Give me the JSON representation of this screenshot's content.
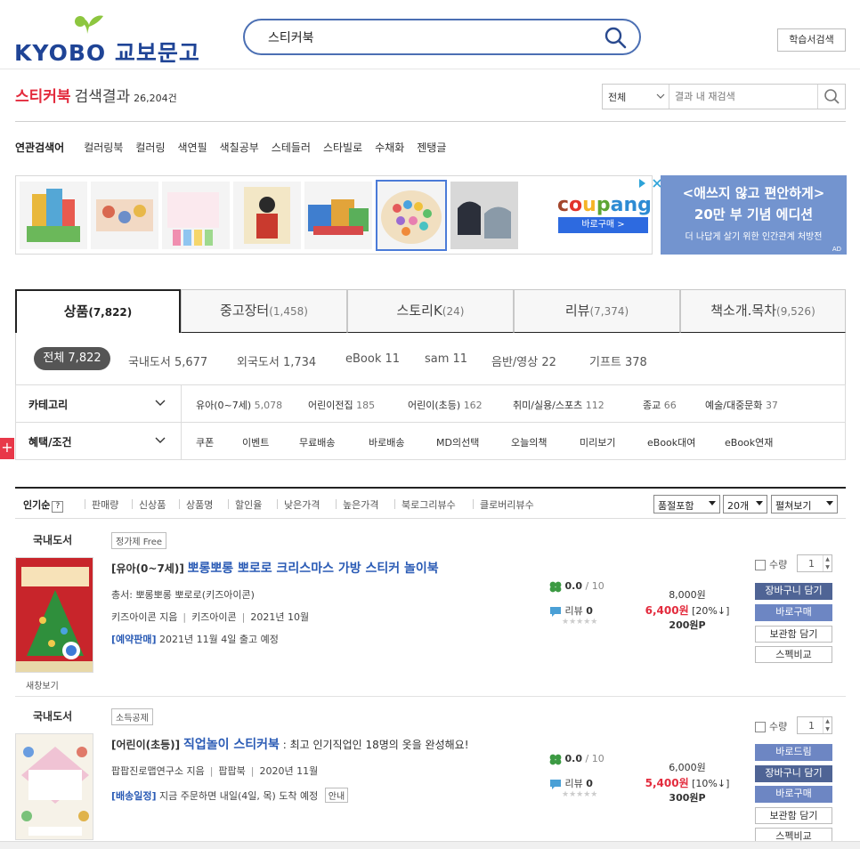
{
  "header": {
    "logo_text": "KYOBO 교보문고",
    "search_value": "스티커북",
    "study_search_label": "학습서검색"
  },
  "result": {
    "keyword": "스티커북",
    "label": "검색결과",
    "count": "26,204건",
    "scope_select": "전체",
    "inner_search_placeholder": "결과 내 재검색"
  },
  "related": {
    "label": "연관검색어",
    "keywords": [
      "컬러링북",
      "컬러링",
      "색연필",
      "색칠공부",
      "스테들러",
      "스타빌로",
      "수채화",
      "젠탱글"
    ]
  },
  "ads": {
    "coupang_brand": "coupang",
    "coupang_button": "바로구매 >",
    "banner_line1": "<애쓰지 않고 편안하게>",
    "banner_line2": "20만 부 기념 에디션",
    "banner_line3": "더 나답게 살기 위한 인간관계 처방전",
    "banner_ad": "AD",
    "colors": {
      "coupang_button": "#2d6ae0",
      "banner_bg": "#7394cf"
    }
  },
  "tabs": [
    {
      "label": "상품",
      "count": "(7,822)"
    },
    {
      "label": "중고장터",
      "count": "(1,458)"
    },
    {
      "label": "스토리K",
      "count": "(24)"
    },
    {
      "label": "리뷰",
      "count": "(7,374)"
    },
    {
      "label": "책소개.목차",
      "count": "(9,526)"
    }
  ],
  "subfilters": {
    "chip": "전체 7,822",
    "items": [
      "국내도서 5,677",
      "외국도서 1,734",
      "eBook 11",
      "sam 11",
      "음반/영상 22",
      "기프트 378"
    ]
  },
  "category": {
    "label": "카테고리",
    "items": [
      {
        "name": "유아(0~7세)",
        "count": "5,078"
      },
      {
        "name": "어린이전집",
        "count": "185"
      },
      {
        "name": "어린이(초등)",
        "count": "162"
      },
      {
        "name": "취미/실용/스포츠",
        "count": "112"
      },
      {
        "name": "종교",
        "count": "66"
      },
      {
        "name": "예술/대중문화",
        "count": "37"
      }
    ]
  },
  "benefit": {
    "label": "혜택/조건",
    "items": [
      "쿠폰",
      "이벤트",
      "무료배송",
      "바로배송",
      "MD의선택",
      "오늘의책",
      "미리보기",
      "eBook대여",
      "eBook연재"
    ]
  },
  "sort": {
    "items": [
      "인기순",
      "판매량",
      "신상품",
      "상품명",
      "할인율",
      "낮은가격",
      "높은가격",
      "북로그리뷰수",
      "클로버리뷰수"
    ],
    "help": "?",
    "sold_out": "품절포함",
    "per_page": "20개",
    "view_mode": "펼쳐보기"
  },
  "products": [
    {
      "category": "국내도서",
      "tag": "정가제 Free",
      "title_prefix": "[유아(0~7세)]",
      "title": "뽀롱뽀롱 뽀로로 크리스마스 가방 스티커 놀이북",
      "subtitle": "",
      "series": "총서: 뽀롱뽀롱 뽀로로(키즈아이콘)",
      "author": "키즈아이콘 지음",
      "publisher": "키즈아이콘",
      "date": "2021년 10월",
      "notice_label": "[예약판매]",
      "notice_text": "2021년 11월 4일 출고 예정",
      "notice_btn": "",
      "preview": "새창보기",
      "rating": "0.0",
      "rating_max": "/ 10",
      "review_label": "리뷰",
      "review_count": "0",
      "stars": "★★★★★",
      "list_price": "8,000원",
      "sale_price": "6,400원",
      "discount": "[20%↓]",
      "points": "200원P",
      "qty_label": "수량",
      "qty": "1",
      "buttons": [
        "장바구니 담기",
        "바로구매",
        "보관함 담기",
        "스펙비교"
      ]
    },
    {
      "category": "국내도서",
      "tag": "소득공제",
      "title_prefix": "[어린이(초등)]",
      "title": "직업놀이 스티커북",
      "subtitle": ": 최고 인기직업인 18명의 옷을 완성해요!",
      "series": "",
      "author": "팝팝진로맵연구소 지음",
      "publisher": "팝팝북",
      "date": "2020년 11월",
      "notice_label": "[배송일정]",
      "notice_text": "지금 주문하면 내일(4일, 목) 도착 예정",
      "notice_btn": "안내",
      "preview": "",
      "rating": "0.0",
      "rating_max": "/ 10",
      "review_label": "리뷰",
      "review_count": "0",
      "stars": "★★★★★",
      "list_price": "6,000원",
      "sale_price": "5,400원",
      "discount": "[10%↓]",
      "points": "300원P",
      "qty_label": "수량",
      "qty": "1",
      "buttons": [
        "바로드림",
        "장바구니 담기",
        "바로구매",
        "보관함 담기",
        "스펙비교"
      ]
    }
  ],
  "side_plus": "+"
}
